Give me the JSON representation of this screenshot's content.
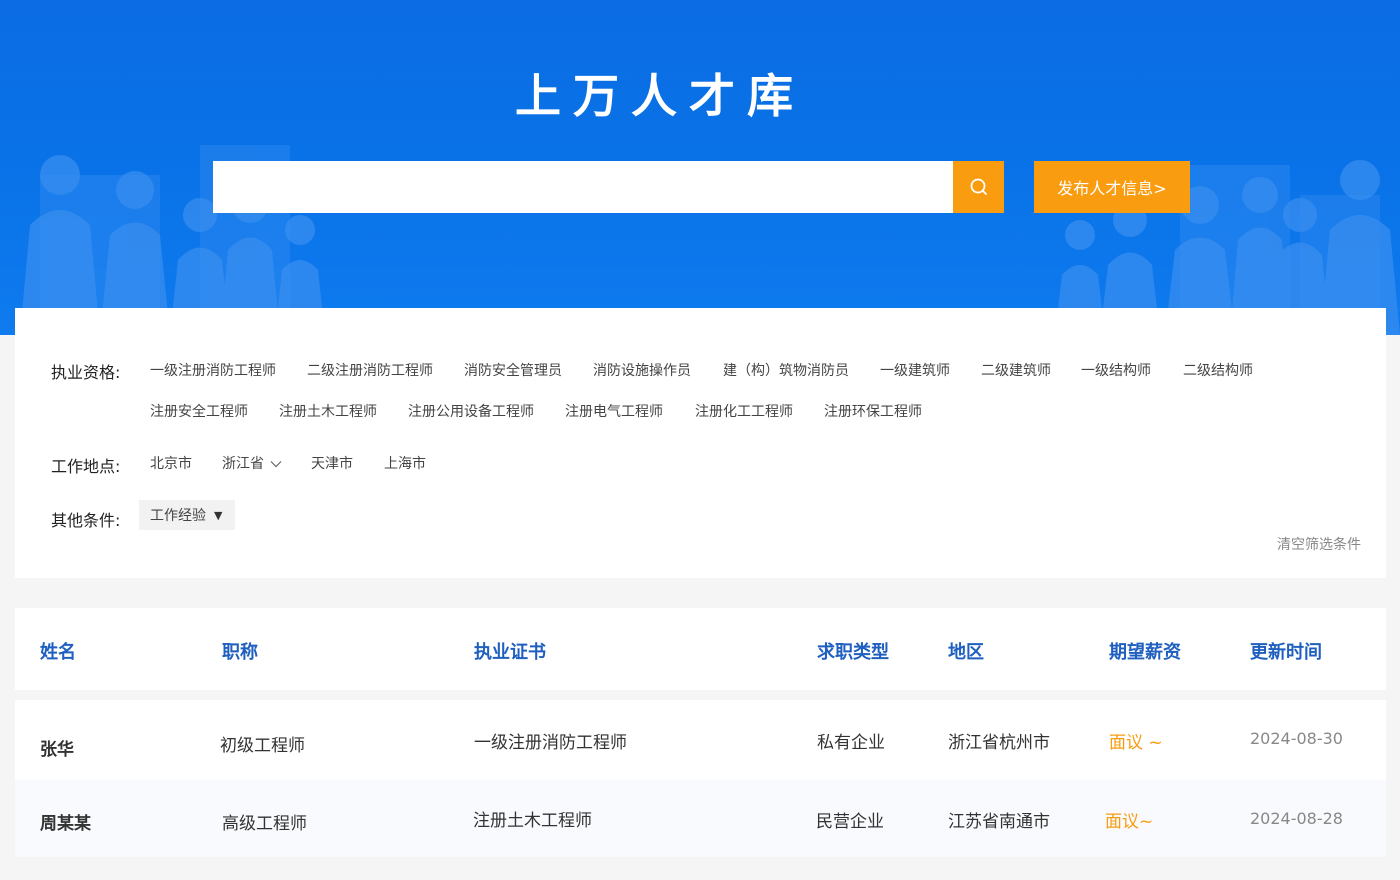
{
  "banner": {
    "title": "上万人才库",
    "search_placeholder": "",
    "search_icon": "search-icon",
    "publish_label": "发布人才信息>"
  },
  "filters": {
    "qualification_label": "执业资格:",
    "qualifications": [
      "一级注册消防工程师",
      "二级注册消防工程师",
      "消防安全管理员",
      "消防设施操作员",
      "建（构）筑物消防员",
      "一级建筑师",
      "二级建筑师",
      "一级结构师",
      "二级结构师",
      "注册安全工程师",
      "注册土木工程师",
      "注册公用设备工程师",
      "注册电气工程师",
      "注册化工工程师",
      "注册环保工程师"
    ],
    "location_label": "工作地点:",
    "locations": [
      "北京市",
      "浙江省",
      "天津市",
      "上海市"
    ],
    "other_label": "其他条件:",
    "experience_label": "工作经验",
    "clear_label": "清空筛选条件"
  },
  "table": {
    "headers": [
      "姓名",
      "职称",
      "执业证书",
      "求职类型",
      "地区",
      "期望薪资",
      "更新时间"
    ],
    "rows": [
      {
        "name": "张华",
        "title": "初级工程师",
        "cert": "一级注册消防工程师",
        "type": "私有企业",
        "region": "浙江省杭州市",
        "salary": "面议 ~",
        "date": "2024-08-30"
      },
      {
        "name": "周某某",
        "title": "高级工程师",
        "cert": "注册土木工程师",
        "type": "民营企业",
        "region": "江苏省南通市",
        "salary": "面议~",
        "date": "2024-08-28"
      }
    ]
  },
  "colors": {
    "brand_blue": "#0a70e6",
    "accent_orange": "#f99c10",
    "header_blue": "#1f5fbf"
  }
}
